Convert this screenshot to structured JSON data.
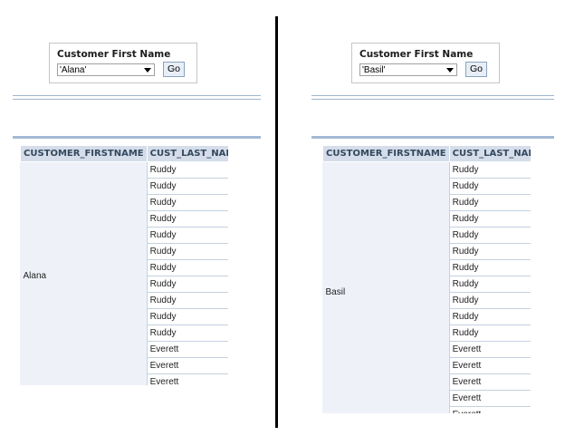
{
  "left": {
    "prompt_label": "Customer First Name",
    "selected_value": "'Alana'",
    "go_label": "Go",
    "columns": [
      "CUSTOMER_FIRSTNAME",
      "CUST_LAST_NAME"
    ],
    "first_name": "Alana",
    "last_names": [
      "Ruddy",
      "Ruddy",
      "Ruddy",
      "Ruddy",
      "Ruddy",
      "Ruddy",
      "Ruddy",
      "Ruddy",
      "Ruddy",
      "Ruddy",
      "Ruddy",
      "Everett",
      "Everett",
      "Everett"
    ]
  },
  "right": {
    "prompt_label": "Customer First Name",
    "selected_value": "'Basil'",
    "go_label": "Go",
    "columns": [
      "CUSTOMER_FIRSTNAME",
      "CUST_LAST_NAME"
    ],
    "first_name": "Basil",
    "last_names": [
      "Ruddy",
      "Ruddy",
      "Ruddy",
      "Ruddy",
      "Ruddy",
      "Ruddy",
      "Ruddy",
      "Ruddy",
      "Ruddy",
      "Ruddy",
      "Ruddy",
      "Everett",
      "Everett",
      "Everett",
      "Everett",
      "Everett"
    ]
  }
}
